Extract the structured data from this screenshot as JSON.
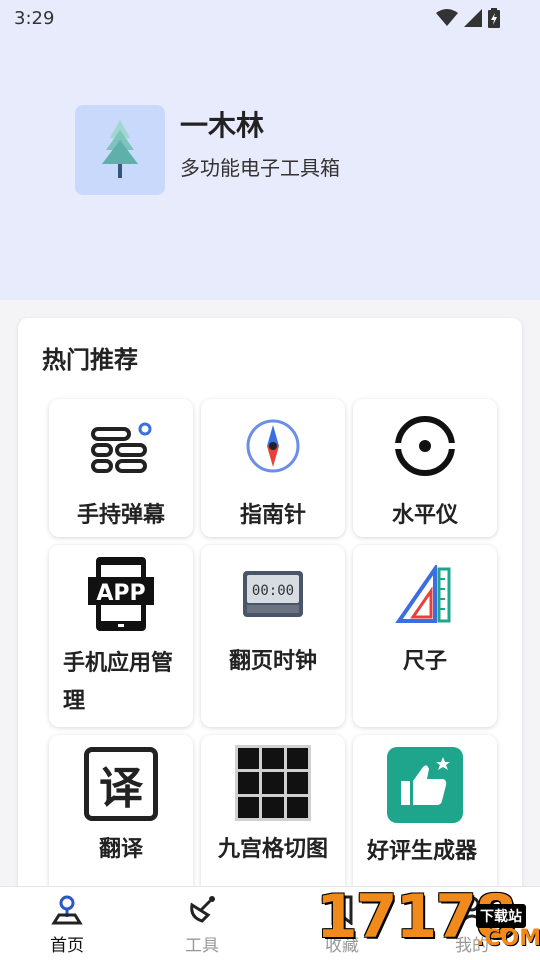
{
  "status_bar": {
    "time": "3:29",
    "icons": [
      "wifi-icon",
      "signal-icon",
      "battery-icon"
    ]
  },
  "app": {
    "name": "一木林",
    "description": "多功能电子工具箱",
    "logo_icon": "tree-icon"
  },
  "section": {
    "title": "热门推荐"
  },
  "tools": [
    {
      "label": "手持弹幕",
      "icon": "barrage-icon"
    },
    {
      "label": "指南针",
      "icon": "compass-icon"
    },
    {
      "label": "水平仪",
      "icon": "level-icon"
    },
    {
      "label": "手机应用管理",
      "icon": "app-manager-icon"
    },
    {
      "label": "翻页时钟",
      "icon": "flip-clock-icon",
      "clock_text": "00:00"
    },
    {
      "label": "尺子",
      "icon": "ruler-icon"
    },
    {
      "label": "翻译",
      "icon": "translate-icon",
      "glyph": "译"
    },
    {
      "label": "九宫格切图",
      "icon": "grid-cut-icon"
    },
    {
      "label": "好评生成器",
      "icon": "thumbs-up-icon"
    }
  ],
  "app_manager_badge": "APP",
  "tabs": [
    {
      "label": "首页",
      "icon": "home-icon",
      "active": true
    },
    {
      "label": "工具",
      "icon": "satellite-dish-icon",
      "active": false
    },
    {
      "label": "收藏",
      "icon": "bookmark-icon",
      "active": false
    },
    {
      "label": "我的",
      "icon": "profile-icon",
      "active": false
    }
  ],
  "watermark": {
    "number": "17178",
    "site": "下载站",
    "domain": ".COM"
  },
  "colors": {
    "header_bg": "#e8ebfb",
    "accent_blue": "#3b6fe0",
    "compass_red": "#e8413c",
    "thumb_green": "#1fa58c",
    "watermark_orange": "#f08a1c"
  }
}
